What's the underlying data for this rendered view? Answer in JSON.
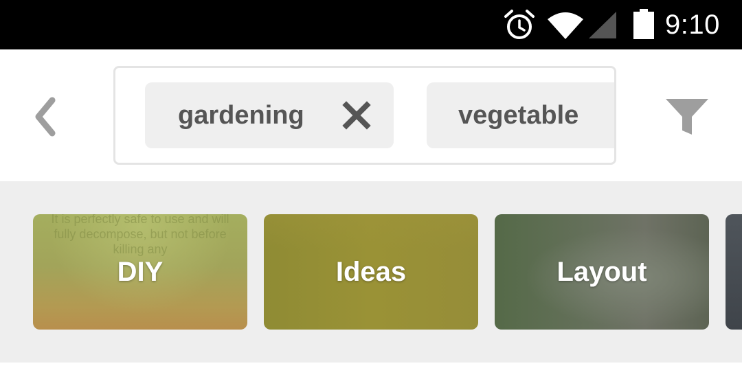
{
  "status_bar": {
    "time": "9:10",
    "icons": [
      "alarm-icon",
      "wifi-icon",
      "cell-signal-icon",
      "battery-icon"
    ]
  },
  "header": {
    "back_icon": "chevron-left-icon",
    "filter_icon": "filter-icon",
    "chips": [
      {
        "label": "gardening",
        "removable": true,
        "remove_icon": "close-icon"
      },
      {
        "label": "vegetable",
        "removable": false
      }
    ]
  },
  "categories": [
    {
      "label": "DIY",
      "background_text": "It is perfectly safe to use and will fully decompose, but not before killing any"
    },
    {
      "label": "Ideas"
    },
    {
      "label": "Layout"
    }
  ],
  "colors": {
    "status_bar_bg": "#000000",
    "chip_bg": "#efefef",
    "chip_text": "#555555",
    "icon_gray": "#9e9e9e",
    "strip_bg": "#eeeeee"
  }
}
